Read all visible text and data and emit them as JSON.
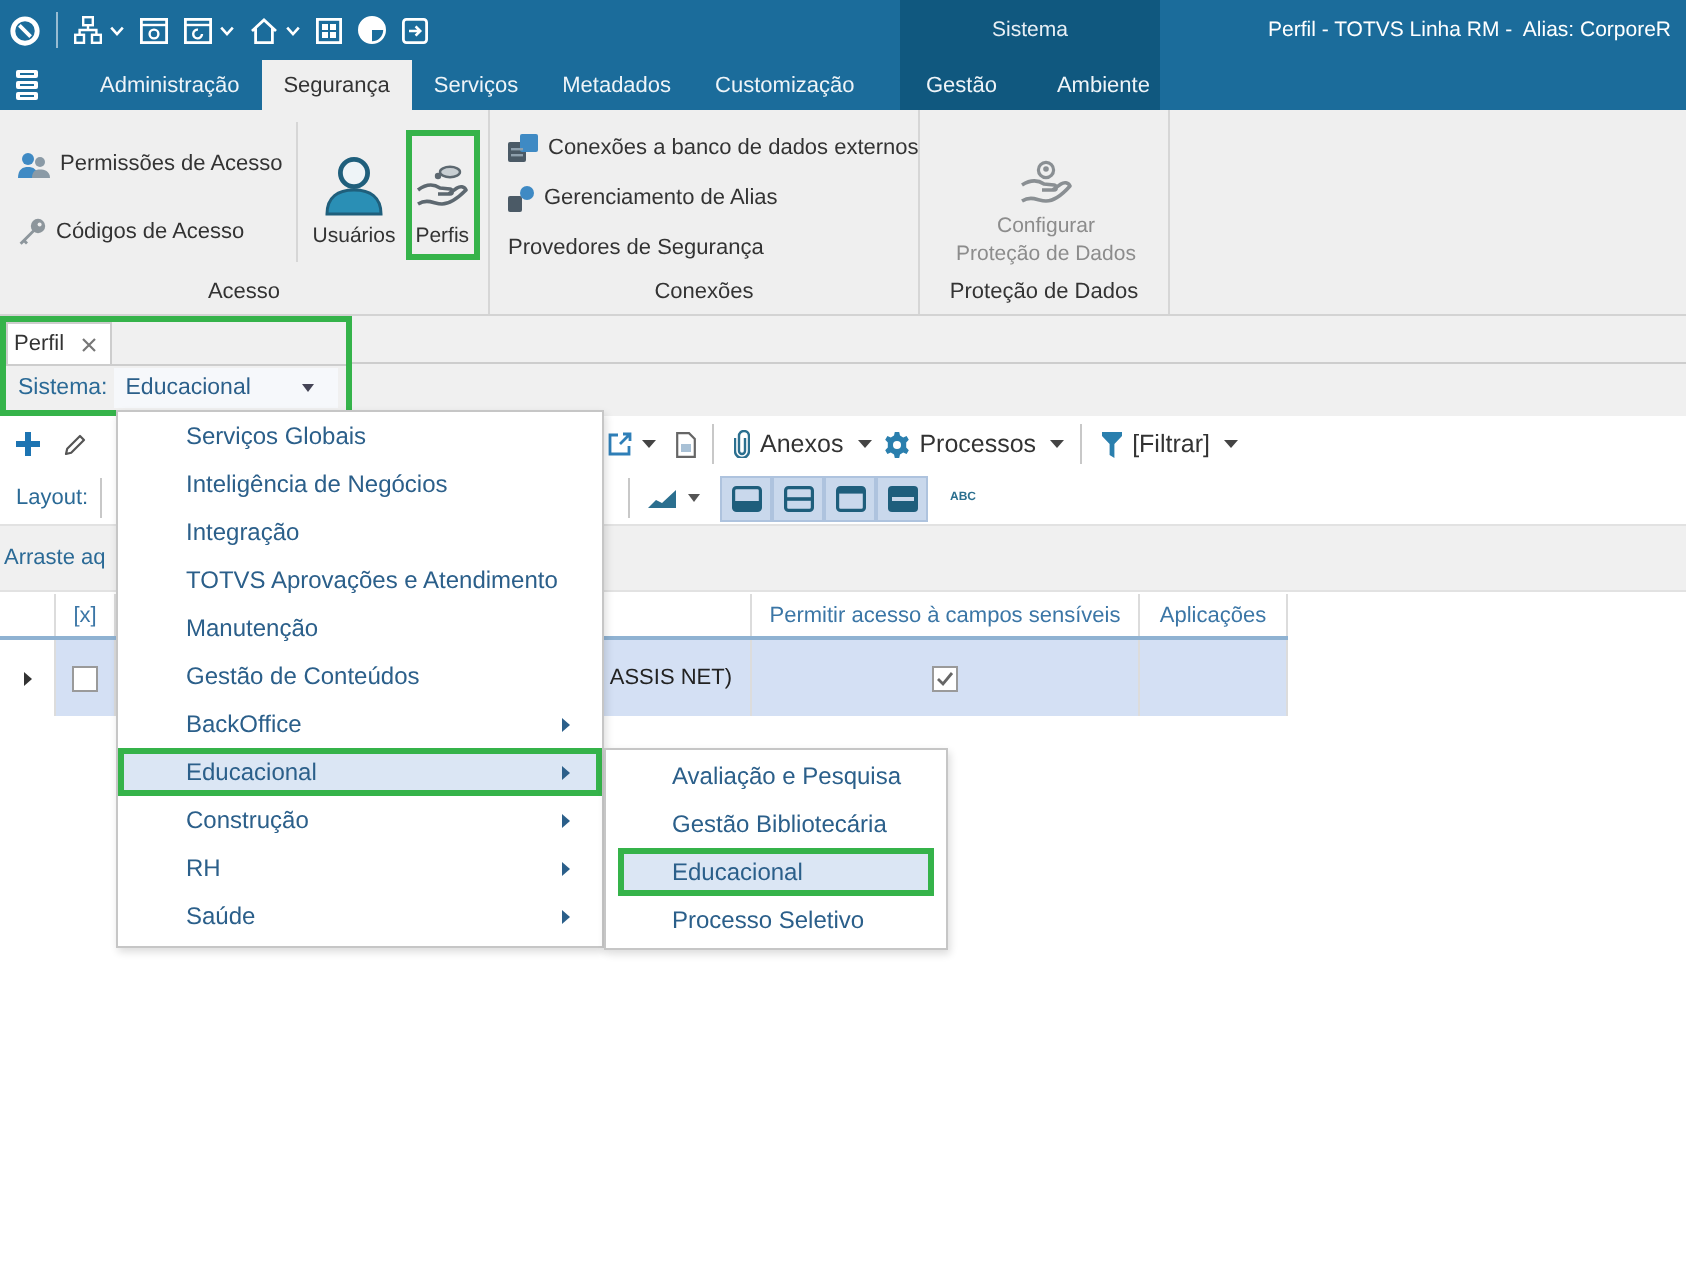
{
  "window": {
    "title": "Perfil - TOTVS Linha RM -  Alias: CorporeR"
  },
  "ribbon": {
    "tabs": [
      {
        "label": "Administração",
        "selected": false
      },
      {
        "label": "Segurança",
        "selected": true
      },
      {
        "label": "Serviços",
        "selected": false
      },
      {
        "label": "Metadados",
        "selected": false
      },
      {
        "label": "Customização",
        "selected": false
      }
    ],
    "context": {
      "label": "Sistema",
      "tabs": [
        {
          "label": "Gestão",
          "selected": false
        },
        {
          "label": "Ambiente",
          "selected": false
        }
      ]
    },
    "groups": [
      {
        "label": "Acesso",
        "items": [
          {
            "kind": "small",
            "label": "Permissões de Acesso",
            "disabled": false,
            "highlighted": false
          },
          {
            "kind": "small",
            "label": "Códigos de Acesso",
            "disabled": false,
            "highlighted": false
          },
          {
            "kind": "large",
            "label": "Usuários",
            "disabled": false,
            "highlighted": false
          },
          {
            "kind": "large",
            "label": "Perfis",
            "disabled": false,
            "highlighted": true
          }
        ]
      },
      {
        "label": "Conexões",
        "items": [
          {
            "kind": "small",
            "label": "Conexões a banco de dados externos",
            "disabled": false,
            "highlighted": false
          },
          {
            "kind": "small",
            "label": "Gerenciamento de Alias",
            "disabled": false,
            "highlighted": false
          },
          {
            "kind": "small",
            "label": "Provedores de Segurança",
            "disabled": false,
            "highlighted": false
          }
        ]
      },
      {
        "label": "Proteção de Dados",
        "items": [
          {
            "kind": "large",
            "label": "Configurar\nProteção de Dados",
            "disabled": true,
            "highlighted": false
          }
        ]
      }
    ]
  },
  "document": {
    "highlighted": true,
    "tabs": [
      {
        "label": "Perfil",
        "selected": true
      }
    ],
    "filter": {
      "label": "Sistema:",
      "value": "Educacional"
    }
  },
  "toolbar": {
    "items": [
      {
        "label": "Anexos"
      },
      {
        "label": "Processos"
      },
      {
        "label": "[Filtrar]"
      }
    ]
  },
  "layout_bar": {
    "label": "Layout:",
    "text_button": "ABC"
  },
  "group_panel": {
    "hint": "Arraste aq"
  },
  "grid": {
    "columns": [
      {
        "label": "[x]"
      },
      {
        "label": "Permitir acesso à campos sensíveis"
      },
      {
        "label": "Aplicações"
      }
    ],
    "rows": [
      {
        "selected": true,
        "checked": false,
        "name": "ASSIS NET)",
        "sensitive_access": true
      }
    ]
  },
  "system_menu": {
    "items": [
      {
        "label": "Serviços Globais",
        "has_submenu": false,
        "selected": false,
        "highlighted": false
      },
      {
        "label": "Inteligência de Negócios",
        "has_submenu": false,
        "selected": false,
        "highlighted": false
      },
      {
        "label": "Integração",
        "has_submenu": false,
        "selected": false,
        "highlighted": false
      },
      {
        "label": "TOTVS Aprovações e Atendimento",
        "has_submenu": false,
        "selected": false,
        "highlighted": false
      },
      {
        "label": "Manutenção",
        "has_submenu": false,
        "selected": false,
        "highlighted": false
      },
      {
        "label": "Gestão de Conteúdos",
        "has_submenu": false,
        "selected": false,
        "highlighted": false
      },
      {
        "label": "BackOffice",
        "has_submenu": true,
        "selected": false,
        "highlighted": false
      },
      {
        "label": "Educacional",
        "has_submenu": true,
        "selected": true,
        "highlighted": true,
        "children": [
          {
            "label": "Avaliação e Pesquisa",
            "selected": false,
            "highlighted": false
          },
          {
            "label": "Gestão Bibliotecária",
            "selected": false,
            "highlighted": false
          },
          {
            "label": "Educacional",
            "selected": true,
            "highlighted": true
          },
          {
            "label": "Processo Seletivo",
            "selected": false,
            "highlighted": false
          }
        ]
      },
      {
        "label": "Construção",
        "has_submenu": true,
        "selected": false,
        "highlighted": false
      },
      {
        "label": "RH",
        "has_submenu": true,
        "selected": false,
        "highlighted": false
      },
      {
        "label": "Saúde",
        "has_submenu": true,
        "selected": false,
        "highlighted": false
      }
    ]
  }
}
